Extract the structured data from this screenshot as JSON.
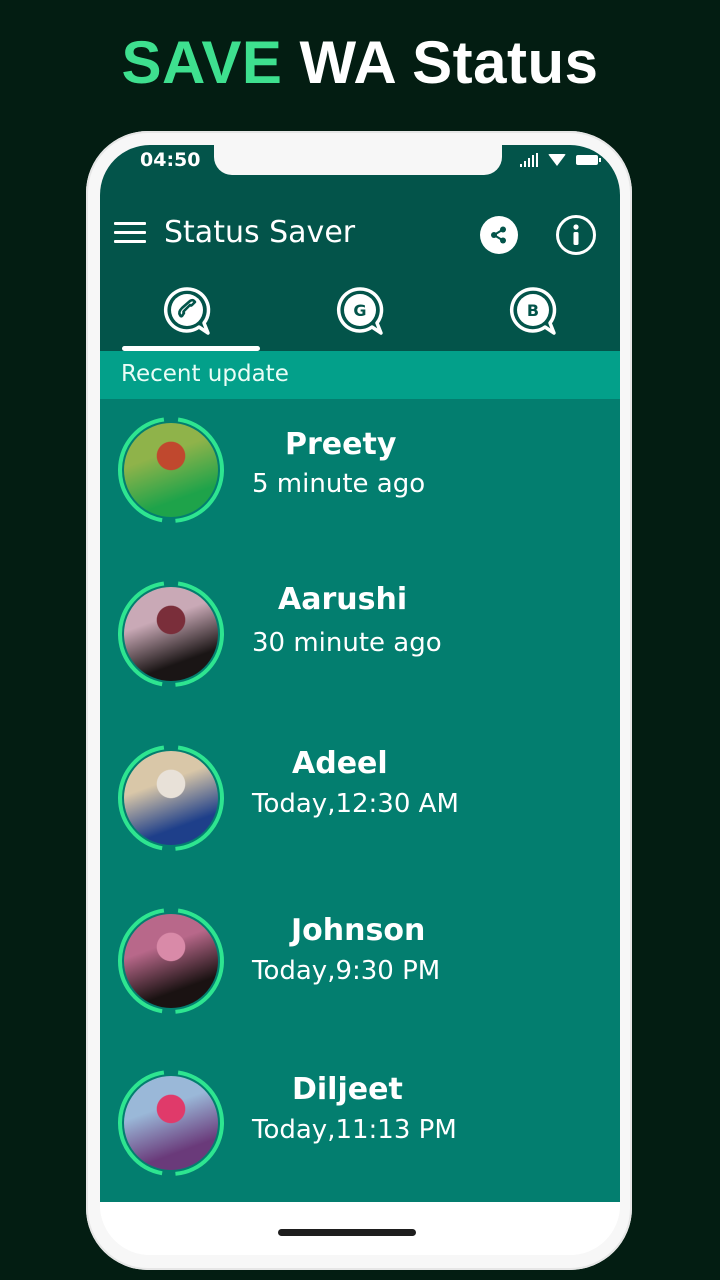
{
  "promo": {
    "accent_word": "SAVE",
    "rest": " WA Status",
    "accent_color": "#3ee08f"
  },
  "status_bar": {
    "time": "04:50",
    "icons": [
      "signal-icon",
      "wifi-icon",
      "battery-icon"
    ]
  },
  "toolbar": {
    "title": "Status Saver",
    "menu_icon": "hamburger-menu-icon",
    "actions": [
      "share-icon",
      "info-icon"
    ]
  },
  "tabs": [
    {
      "name": "whatsapp",
      "glyph": "phone",
      "active": true
    },
    {
      "name": "gb-whatsapp",
      "glyph": "G",
      "active": false
    },
    {
      "name": "whatsapp-business",
      "glyph": "B",
      "active": false
    }
  ],
  "section": {
    "title": "Recent update"
  },
  "contacts": [
    {
      "name": "Preety",
      "time": "5 minute ago",
      "photo_colors": [
        "#8fb34a",
        "#1ea34a",
        "#c0482e"
      ]
    },
    {
      "name": "Aarushi",
      "time": "30 minute ago",
      "photo_colors": [
        "#c9a9b6",
        "#1a1515",
        "#7a2e3a"
      ]
    },
    {
      "name": "Adeel",
      "time": "Today,12:30 AM",
      "photo_colors": [
        "#d9c7a8",
        "#1e3f8a",
        "#e8e1d8"
      ]
    },
    {
      "name": "Johnson",
      "time": "Today,9:30 PM",
      "photo_colors": [
        "#b8688a",
        "#1a1212",
        "#d98aa8"
      ]
    },
    {
      "name": "Diljeet",
      "time": "Today,11:13 PM",
      "photo_colors": [
        "#9ab8d8",
        "#6a3a7a",
        "#e03a6a"
      ]
    }
  ],
  "colors": {
    "header": "#03544a",
    "section": "#03a08a",
    "list": "#037e6f",
    "ring": "#2ee590"
  }
}
